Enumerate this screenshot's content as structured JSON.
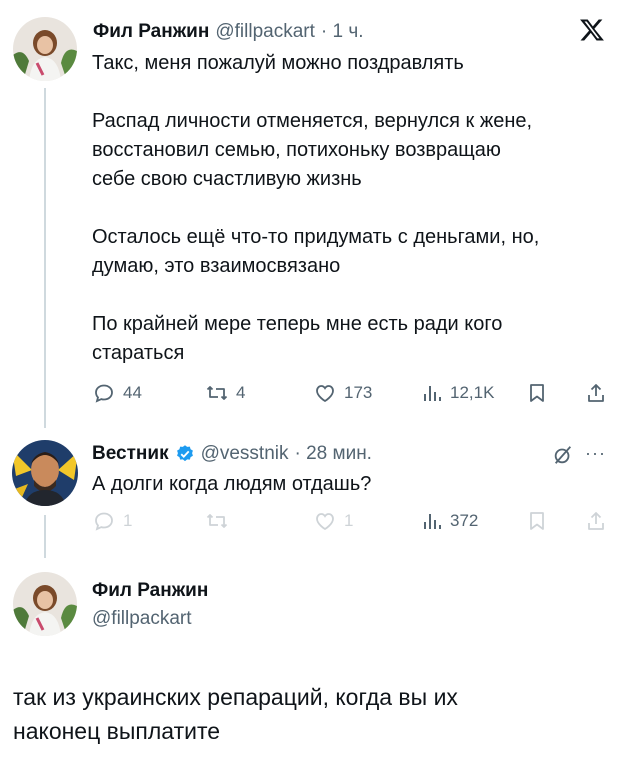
{
  "colors": {
    "text": "#0f1419",
    "muted": "#536471",
    "verified": "#1d9bf0",
    "thread_line": "#cfd9de"
  },
  "tweet1": {
    "author_name": "Фил Ранжин",
    "handle": "@fillpackart",
    "time": "· 1 ч.",
    "text_lines": [
      "Такс, меня пожалуй можно поздравлять",
      "",
      "Распад личности отменяется, вернулся к жене,",
      "восстановил семью, потихоньку возвращаю",
      "себе свою счастливую жизнь",
      "",
      "Осталось ещё что-то придумать с деньгами, но,",
      "думаю, это взаимосвязано",
      "",
      "По крайней мере теперь мне есть ради кого",
      "стараться"
    ],
    "replies": "44",
    "reposts": "4",
    "likes": "173",
    "views": "12,1K"
  },
  "tweet2": {
    "author_name": "Вестник",
    "handle": "@vesstnik",
    "time": "· 28 мин.",
    "text": "А долги когда людям отдашь?",
    "replies": "1",
    "likes": "1",
    "views": "372",
    "more_label": "···"
  },
  "tweet3": {
    "author_name": "Фил Ранжин",
    "handle": "@fillpackart",
    "text_lines": [
      "так из украинских репараций, когда вы их",
      "наконец выплатите"
    ]
  },
  "icons": [
    "x-logo-icon",
    "reply-icon",
    "repost-icon",
    "like-icon",
    "views-icon",
    "bookmark-icon",
    "share-icon",
    "verified-badge-icon",
    "grok-icon",
    "more-icon"
  ]
}
